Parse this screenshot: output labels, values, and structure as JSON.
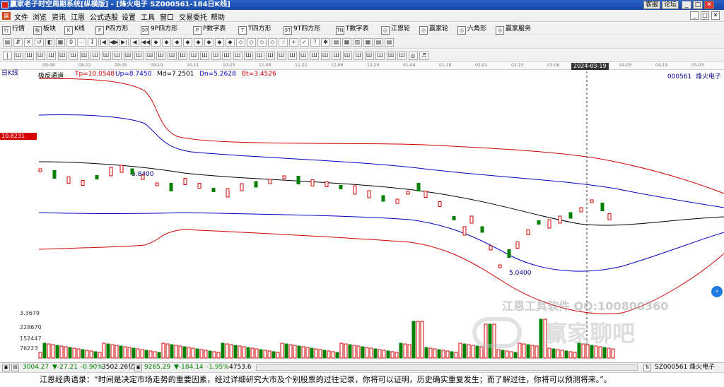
{
  "window": {
    "title": "赢家老子时空周期系统[纵横版] - [烽火电子   SZ000561-184日K线]",
    "buttons": [
      "客服",
      "论坛"
    ],
    "win_controls": [
      "_",
      "□",
      "✕"
    ]
  },
  "menu": {
    "icon_text": "赢",
    "items": [
      "文件",
      "浏览",
      "资讯",
      "江恩",
      "公式选股",
      "设置",
      "工具",
      "窗口",
      "交易委托",
      "帮助"
    ],
    "mdi_controls": [
      "_",
      "□",
      "✕"
    ]
  },
  "toolbar1": {
    "items": [
      {
        "icon": "行",
        "label": "行情"
      },
      {
        "icon": "板",
        "label": "板块"
      },
      {
        "icon": "K",
        "label": "K线"
      },
      {
        "icon": "P",
        "label": "P四方形"
      },
      {
        "icon": "9P",
        "label": "9P四方形"
      },
      {
        "icon": "P",
        "label": "P数字表"
      },
      {
        "icon": "T",
        "label": "T四方形"
      },
      {
        "icon": "9T",
        "label": "9T四方形"
      },
      {
        "icon": "TN",
        "label": "T数字表"
      },
      {
        "icon": "◎",
        "label": "江恩轮"
      },
      {
        "icon": "◎",
        "label": "赢家轮"
      },
      {
        "icon": "◎",
        "label": "六角形"
      },
      {
        "icon": "◎",
        "label": "赢家服务"
      }
    ]
  },
  "toolbar2": {
    "buttons": [
      "▤",
      "⇵",
      "✕",
      "↺",
      "◧",
      "▦",
      "0",
      "⋯",
      "↧",
      "|◀",
      "◀▶",
      "▶|",
      "◀",
      "◀◀",
      "◆",
      "◆",
      "◆",
      "◆",
      "◆",
      "◆",
      "◆",
      "◆",
      "◇",
      "◇",
      "◇",
      "◇",
      "☝",
      "+",
      "✓",
      "?",
      "✱",
      "▤",
      "▦",
      "▥",
      "▦",
      "▤",
      "▤"
    ]
  },
  "toolbar3": {
    "buttons": [
      "|",
      "Ш",
      "Ш",
      "Ш",
      "Ш",
      "Ш",
      "Ш",
      "Ш",
      "Ш",
      "Ш",
      "Ш",
      "Ш",
      "Ш",
      "Ш",
      "Ш",
      "Ш",
      "Ш",
      "Ш",
      "Ш",
      "Ш",
      "Ш",
      "Ш",
      "Ш",
      "Ш",
      "Ш",
      "Ш",
      "Ш",
      "Ш",
      "Ш",
      "Ш",
      "Ш",
      "Ш",
      "Ш",
      "Ш",
      "Ш",
      "Ш",
      "Ш",
      "◎",
      "♬"
    ]
  },
  "chart": {
    "period": "日K线",
    "indicator_name": "极反通道",
    "indicators": [
      {
        "label": "Tp=10.0548",
        "color": "#d00000"
      },
      {
        "label": "Up=8.7450",
        "color": "#0000c0"
      },
      {
        "label": "Md=7.2501",
        "color": "#000000"
      },
      {
        "label": "Dn=5.2628",
        "color": "#0000c0"
      },
      {
        "label": "Bt=3.4526",
        "color": "#d00000"
      }
    ],
    "stock_code": "000561",
    "stock_name": "烽火电子",
    "price_tag": "10.8231",
    "cursor_date": "2024-03-19",
    "high_annotation": "5.8400",
    "low_annotation": "5.0400",
    "date_ticks": [
      "09-08",
      "08-22",
      "09-05",
      "09-19",
      "10-11",
      "10-25",
      "11-08",
      "11-22",
      "12-06",
      "12-20",
      "01-04",
      "01-18",
      "02-01",
      "02-23",
      "03-06",
      "03-19",
      "04-05",
      "04-19",
      "05-03"
    ],
    "volume_labels": [
      "3.3679",
      "228670",
      "152447",
      "76223"
    ],
    "watermark_line1": "江恩工具软件  QQ:100800360",
    "watermark_line2": "赢家聊吧"
  },
  "index_bar": {
    "sh": {
      "value": "3004.27",
      "change": "▼-27.21",
      "pct": "-0.90%",
      "amount": "3502.26亿"
    },
    "sz": {
      "value": "9265.29",
      "change": "▼-184.14",
      "pct": "-1.95%",
      "amount": "4753.6"
    },
    "right": "SZ000561 烽火电子"
  },
  "quote": {
    "text": "江恩经典语录：“时间是决定市场走势的重要因素，经过详细研究大市及个别股票的过往记录，你将可以证明，历史确实重复发生；而了解过往，你将可以预测将来。”。"
  }
}
